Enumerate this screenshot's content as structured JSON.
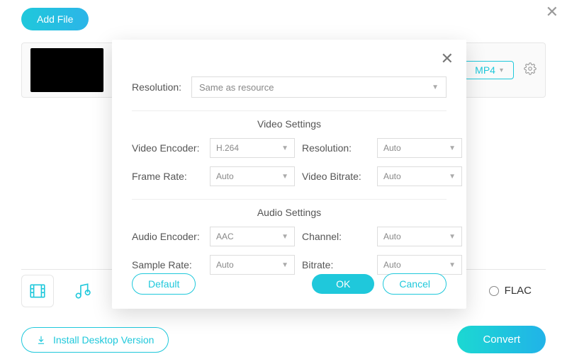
{
  "header": {
    "add_file": "Add File"
  },
  "file": {
    "format_badge": "MP4"
  },
  "options": {
    "flac_label": "FLAC"
  },
  "footer": {
    "install": "Install Desktop Version",
    "convert": "Convert"
  },
  "modal": {
    "resolution_label": "Resolution:",
    "resolution_value": "Same as resource",
    "video_section": "Video Settings",
    "audio_section": "Audio Settings",
    "video": {
      "encoder_label": "Video Encoder:",
      "encoder_value": "H.264",
      "resolution_label": "Resolution:",
      "resolution_value": "Auto",
      "framerate_label": "Frame Rate:",
      "framerate_value": "Auto",
      "bitrate_label": "Video Bitrate:",
      "bitrate_value": "Auto"
    },
    "audio": {
      "encoder_label": "Audio Encoder:",
      "encoder_value": "AAC",
      "channel_label": "Channel:",
      "channel_value": "Auto",
      "samplerate_label": "Sample Rate:",
      "samplerate_value": "Auto",
      "bitrate_label": "Bitrate:",
      "bitrate_value": "Auto"
    },
    "buttons": {
      "default": "Default",
      "ok": "OK",
      "cancel": "Cancel"
    }
  }
}
